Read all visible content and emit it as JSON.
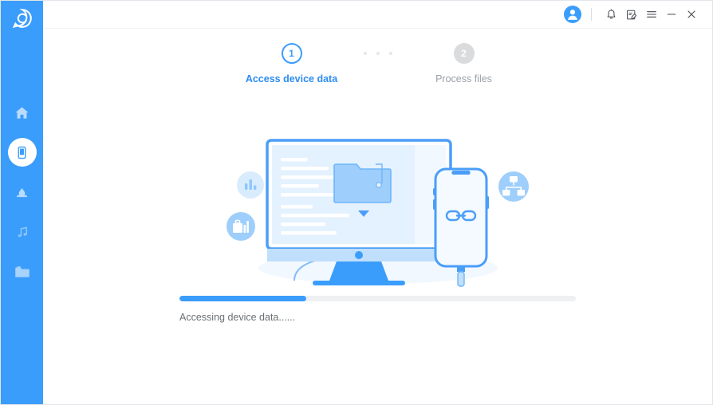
{
  "app": {
    "logo_icon": "circle-c-logo-icon",
    "accent_color": "#3b9dfb",
    "inactive_color": "#9aa0a6"
  },
  "sidebar": {
    "items": [
      {
        "name": "home",
        "icon": "home-icon",
        "active": false
      },
      {
        "name": "device",
        "icon": "phone-device-icon",
        "active": true
      },
      {
        "name": "cloud",
        "icon": "cloud-drop-icon",
        "active": false
      },
      {
        "name": "music",
        "icon": "music-note-icon",
        "active": false
      },
      {
        "name": "files",
        "icon": "folder-icon",
        "active": false
      }
    ]
  },
  "titlebar": {
    "avatar_icon": "user-avatar-icon",
    "buttons": [
      {
        "name": "notifications",
        "icon": "bell-icon"
      },
      {
        "name": "feedback",
        "icon": "note-edit-icon"
      },
      {
        "name": "menu",
        "icon": "hamburger-menu-icon"
      },
      {
        "name": "minimize",
        "icon": "minimize-icon"
      },
      {
        "name": "close",
        "icon": "close-icon"
      }
    ]
  },
  "steps": [
    {
      "number": "1",
      "label": "Access device data",
      "state": "active"
    },
    {
      "number": "2",
      "label": "Process files",
      "state": "inactive"
    }
  ],
  "illustration": {
    "name": "device-connect-illustration",
    "badges": [
      {
        "name": "bar-chart-badge",
        "icon": "bar-chart-icon"
      },
      {
        "name": "briefcase-chart-badge",
        "icon": "briefcase-chart-icon"
      },
      {
        "name": "network-badge",
        "icon": "network-hierarchy-icon"
      }
    ],
    "monitor_icon": "desktop-monitor-icon",
    "folder_icon": "folder-download-icon",
    "phone_icon": "smartphone-icon",
    "link_icon": "chain-link-icon"
  },
  "progress": {
    "percent": 32,
    "fill_width": "32%",
    "status_text": "Accessing device data......"
  }
}
